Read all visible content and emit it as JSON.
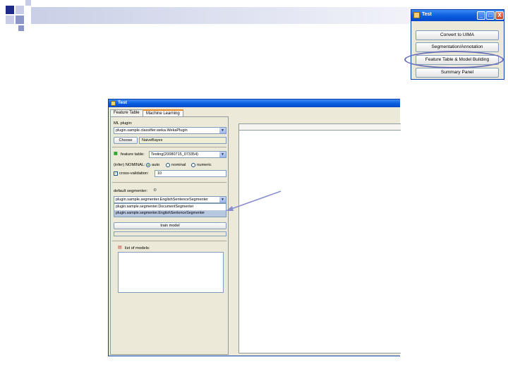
{
  "tool_window": {
    "title": "Test",
    "buttons": [
      "Convert to UIMA",
      "Segmentation/Annotation",
      "Feature Table & Model Building",
      "Summary Panel"
    ],
    "minimize": "_",
    "maximize": "□",
    "close": "X"
  },
  "main_window": {
    "title": "Test",
    "tabs": [
      "Feature Table",
      "Machine Learning"
    ],
    "ml_plugin_label": "ML plugin:",
    "ml_plugin_value": "plugin.sample.classifier.weka.WekaPlugin",
    "choose_button": "Choose",
    "classifier_value": "NaiveBayes",
    "feature_table_label": "feature table:",
    "feature_table_value": "Testing(20080715_073354)",
    "mode_label": "(infer) NOMINAL:",
    "mode_options": [
      "auto",
      "nominal",
      "numeric"
    ],
    "mode_selected": "auto",
    "cross_validation_label": "cross-validation:",
    "cross_validation_value": "10",
    "segmenter_label": "default segmenter:",
    "segmenter_value": "plugin.sample.segmenter.EnglishSentenceSegmenter",
    "segmenter_options": [
      "plugin.sample.segmenter.DocumentSegmenter",
      "plugin.sample.segmenter.EnglishSentenceSegmenter"
    ],
    "train_button": "train model",
    "models_label": "list of models:"
  }
}
